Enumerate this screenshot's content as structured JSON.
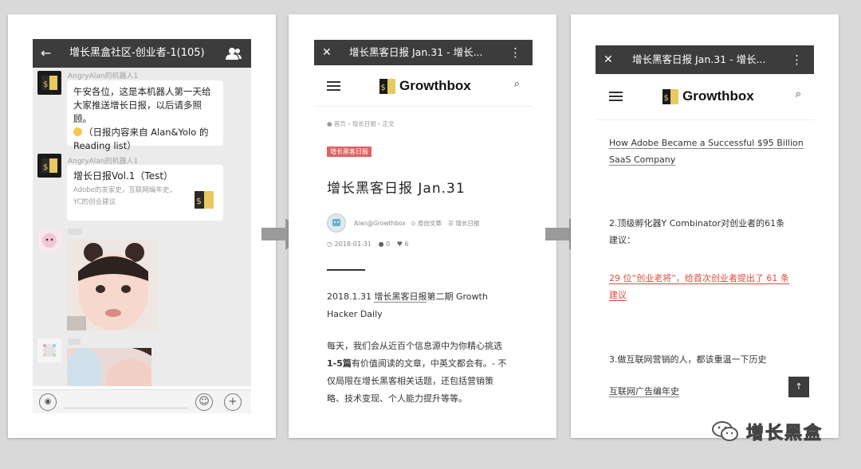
{
  "chat": {
    "back_glyph": "←",
    "title": "增长黑盒社区-创业者-1(105)",
    "messages": [
      {
        "sender": "AngryAlan的机器人1",
        "lines": [
          "午安各位，这是本机器人第一天给",
          "大家推送增长日报，以后请多照顾。",
          "（日报内容来自 Alan&Yolo 的",
          "Reading list）"
        ]
      },
      {
        "sender": "AngryAlan的机器人1",
        "card_title": "增长日报Vol.1（Test）",
        "card_desc": [
          "Adobe的发家史，互联网编年史，",
          "YC的创业建议"
        ]
      }
    ]
  },
  "article1": {
    "top_title": "增长黑客日报 Jan.31 - 增长...",
    "close_glyph": "✕",
    "more_glyph": "⋮",
    "logo": "Growthbox",
    "breadcrumb": [
      "首页",
      "增长日报",
      "正文"
    ],
    "tag": "增长黑客日报",
    "title": "增长黑客日报 Jan.31",
    "author": "Alan@Growthbox",
    "original": "原创文章",
    "category": "增长日报",
    "date": "2018-01-31",
    "comments": "0",
    "likes": "6",
    "para1_pre": "2018.1.31 ",
    "para1_link": "增长黑客日报",
    "para1_post": "第二期 Growth",
    "para1_line2": "Hacker Daily",
    "para2_line1": "每天，我们会从近百个信息源中为你精心挑选",
    "para2_bold": "1-5篇",
    "para2_line2": "有价值阅读的文章，中英文都会有。- 不",
    "para2_line3": "仅局限在增长黑客相关话题，还包括营销策",
    "para2_line4": "略、技术变现、个人能力提升等等。"
  },
  "article2": {
    "top_title": "增长黑客日报 Jan.31 - 增长...",
    "close_glyph": "✕",
    "more_glyph": "⋮",
    "logo": "Growthbox",
    "link1_line1": "How Adobe Became a Successful $95 Billion",
    "link1_line2": "SaaS Company",
    "item2_line1": "2.顶级孵化器Y Combinator对创业者的61条",
    "item2_line2": "建议：",
    "link2_line1": "29 位“创业老将”，给首次创业者提出了 61 条",
    "link2_line2": "建议",
    "item3": "3.做互联网营销的人，都该重温一下历史",
    "link3": "互联网广告编年史",
    "top_btn": "↑"
  },
  "watermark": "增长黑盒"
}
